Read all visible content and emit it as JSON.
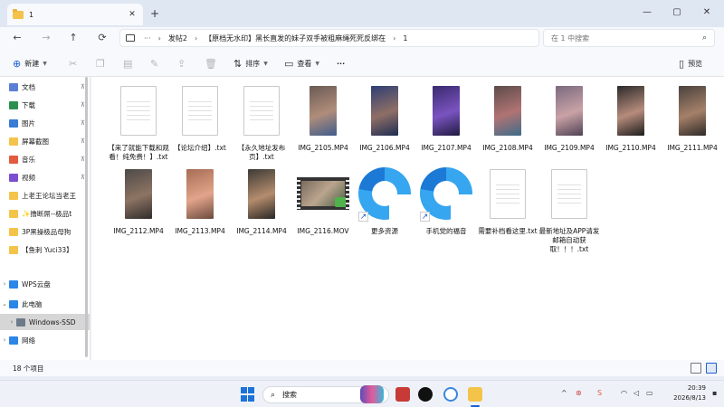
{
  "window": {
    "tab_title": "1",
    "tab_close": "✕",
    "new_tab": "+",
    "controls": [
      "—",
      "▢",
      "✕"
    ]
  },
  "nav": {
    "back": "←",
    "forward": "→",
    "up": "↑",
    "refresh": "⟳",
    "more": "···",
    "breadcrumbs": [
      "发帖2",
      "【原档无水印】黑长直发的妹子双手被粗麻绳死死反绑在",
      "1"
    ],
    "separator": "›",
    "search_placeholder": "在 1 中搜索"
  },
  "commandbar": {
    "new": "新建",
    "sort": "排序",
    "view": "查看",
    "more": "···",
    "preview": "预览"
  },
  "sidebar": {
    "items": [
      {
        "label": "文档",
        "icon": "document-icon",
        "color": "#5b7fd6",
        "pinned": true
      },
      {
        "label": "下载",
        "icon": "download-icon",
        "color": "#2c8f4e",
        "pinned": true
      },
      {
        "label": "图片",
        "icon": "pictures-icon",
        "color": "#3a7bd5",
        "pinned": true
      },
      {
        "label": "屏幕截图",
        "icon": "folder-icon",
        "color": "#f3c34a",
        "pinned": true
      },
      {
        "label": "音乐",
        "icon": "music-icon",
        "color": "#e15b3c",
        "pinned": true
      },
      {
        "label": "视频",
        "icon": "video-icon",
        "color": "#7b4fd0",
        "pinned": true
      },
      {
        "label": "上老王论坛当老王",
        "icon": "folder-icon",
        "color": "#f3c34a",
        "pinned": false
      },
      {
        "label": "✨撸断屌--极品t",
        "icon": "folder-icon",
        "color": "#f3c34a",
        "pinned": false
      },
      {
        "label": "3P黑操极品母狗",
        "icon": "folder-icon",
        "color": "#f3c34a",
        "pinned": false
      },
      {
        "label": "【鱼刺 Yuci33】",
        "icon": "folder-icon",
        "color": "#f3c34a",
        "pinned": false
      },
      {
        "label": "WPS云盘",
        "icon": "cloud-icon",
        "color": "#2b86e8",
        "pinned": false
      },
      {
        "label": "此电脑",
        "icon": "computer-icon",
        "color": "#2b86e8",
        "pinned": false
      },
      {
        "label": "Windows-SSD",
        "icon": "drive-icon",
        "color": "#6d7a8a",
        "pinned": false
      },
      {
        "label": "网络",
        "icon": "network-icon",
        "color": "#2b86e8",
        "pinned": false
      }
    ]
  },
  "files": [
    {
      "name": "【来了就能下载和观看！纯免费！】.txt",
      "type": "doc"
    },
    {
      "name": "【论坛介绍】.txt",
      "type": "doc"
    },
    {
      "name": "【永久地址发布页】.txt",
      "type": "doc"
    },
    {
      "name": "IMG_2105.MP4",
      "type": "video",
      "colors": [
        "#6b5a55",
        "#b08d7a",
        "#3e5b8c"
      ]
    },
    {
      "name": "IMG_2106.MP4",
      "type": "video",
      "colors": [
        "#2f3e74",
        "#8f6f66",
        "#1d2c52"
      ]
    },
    {
      "name": "IMG_2107.MP4",
      "type": "video",
      "colors": [
        "#3a2a6e",
        "#7a53c0",
        "#201a3f"
      ]
    },
    {
      "name": "IMG_2108.MP4",
      "type": "video",
      "colors": [
        "#5c4c4a",
        "#b07373",
        "#3d6c8a"
      ]
    },
    {
      "name": "IMG_2109.MP4",
      "type": "video",
      "colors": [
        "#7b6a7e",
        "#c9a2a6",
        "#4f4254"
      ]
    },
    {
      "name": "IMG_2110.MP4",
      "type": "video",
      "colors": [
        "#2c2a2a",
        "#b68c7c",
        "#1c1c1c"
      ]
    },
    {
      "name": "IMG_2111.MP4",
      "type": "video",
      "colors": [
        "#4a423d",
        "#a58069",
        "#2e2a28"
      ]
    },
    {
      "name": "IMG_2112.MP4",
      "type": "video",
      "colors": [
        "#4d4a48",
        "#8d7463",
        "#2f2c2b"
      ]
    },
    {
      "name": "IMG_2113.MP4",
      "type": "video",
      "colors": [
        "#a66d55",
        "#e2a48a",
        "#6b4a3e"
      ]
    },
    {
      "name": "IMG_2114.MP4",
      "type": "video",
      "colors": [
        "#3c3a36",
        "#b48c6d",
        "#292725"
      ]
    },
    {
      "name": "IMG_2116.MOV",
      "type": "movie"
    },
    {
      "name": "更多资源",
      "type": "shortcut"
    },
    {
      "name": "手机党的福音",
      "type": "shortcut"
    },
    {
      "name": "需要补档看这里.txt",
      "type": "doc"
    },
    {
      "name": "最新地址及APP请发邮箱自动获取！！！.txt",
      "type": "doc"
    }
  ],
  "status": {
    "item_count": "18 个项目"
  },
  "taskbar": {
    "search_label": "搜索",
    "clock_time": "20:39",
    "clock_date": "2026/8/13",
    "tray_chevron": "^"
  }
}
